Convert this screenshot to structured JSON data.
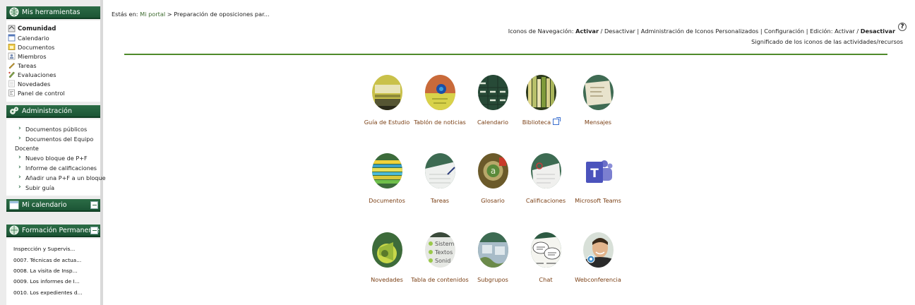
{
  "sidebar": {
    "tools": {
      "title": "Mis herramientas",
      "items": [
        {
          "label": "Comunidad",
          "icon": "home-icon",
          "bold": true
        },
        {
          "label": "Calendario",
          "icon": "calendar-icon"
        },
        {
          "label": "Documentos",
          "icon": "folder-icon"
        },
        {
          "label": "Miembros",
          "icon": "members-icon"
        },
        {
          "label": "Tareas",
          "icon": "pencil-icon"
        },
        {
          "label": "Evaluaciones",
          "icon": "evaluation-icon"
        },
        {
          "label": "Novedades",
          "icon": "news-icon"
        },
        {
          "label": "Panel de control",
          "icon": "control-panel-icon"
        }
      ]
    },
    "admin": {
      "title": "Administración",
      "items": [
        {
          "label": "Documentos públicos"
        },
        {
          "label": "Documentos del Equipo",
          "continuation": "Docente"
        },
        {
          "label": "Nuevo bloque de P+F"
        },
        {
          "label": "Informe de calificaciones"
        },
        {
          "label": "Añadir una P+F a un bloque"
        },
        {
          "label": "Subir guía"
        }
      ]
    },
    "calendar": {
      "title": "Mi calendario"
    },
    "formacion": {
      "title": "Formación Permanente",
      "items": [
        "Inspección y Supervis...",
        "0007. Técnicas de actua...",
        "0008. La visita de Insp...",
        "0009. Los informes de I...",
        "0010. Los expedientes d..."
      ]
    }
  },
  "breadcrumb": {
    "prefix": "Estás en:",
    "home": "Mi portal",
    "separator": ">",
    "current": "Preparación de oposiciones par..."
  },
  "navbar": {
    "icons_nav_label": "Iconos de Navegación:",
    "activar": "Activar",
    "slash": "/",
    "desactivar": "Desactivar",
    "pipe": "|",
    "admin_icons": "Administración de Iconos Personalizados",
    "config": "Configuración",
    "edicion_label": "Edición:",
    "edicion_activar": "Activar",
    "edicion_desactivar": "Desactivar",
    "help": "?",
    "meaning": "Significado de los iconos de las actividades/recursos"
  },
  "tiles": [
    {
      "id": "guia",
      "label": "Guía de Estudio",
      "icon": "study-guide-icon"
    },
    {
      "id": "tablon",
      "label": "Tablón de noticias",
      "icon": "noticeboard-icon"
    },
    {
      "id": "calendario",
      "label": "Calendario",
      "icon": "calendar-tile-icon"
    },
    {
      "id": "biblioteca",
      "label": "Biblioteca",
      "icon": "library-icon",
      "external": true
    },
    {
      "id": "mensajes",
      "label": "Mensajes",
      "icon": "messages-icon"
    },
    {
      "id": "documentos",
      "label": "Documentos",
      "icon": "documents-icon"
    },
    {
      "id": "tareas",
      "label": "Tareas",
      "icon": "tasks-icon"
    },
    {
      "id": "glosario",
      "label": "Glosario",
      "icon": "glossary-icon"
    },
    {
      "id": "calificaciones",
      "label": "Calificaciones",
      "icon": "grades-icon"
    },
    {
      "id": "teams",
      "label": "Microsoft Teams",
      "icon": "microsoft-teams-icon"
    },
    {
      "id": "novedades",
      "label": "Novedades",
      "icon": "news-megaphone-icon"
    },
    {
      "id": "tabla",
      "label": "Tabla de contenidos",
      "icon": "table-of-contents-icon",
      "thumb_text": [
        "Sistem",
        "Textos",
        "Sonid"
      ]
    },
    {
      "id": "subgrupos",
      "label": "Subgrupos",
      "icon": "subgroups-icon"
    },
    {
      "id": "chat",
      "label": "Chat",
      "icon": "chat-icon"
    },
    {
      "id": "webconf",
      "label": "Webconferencia",
      "icon": "webconference-icon"
    }
  ],
  "colors": {
    "sidebar_header": "#2c6c46",
    "divider": "#4f8a2b",
    "tile_label": "#7a3f14",
    "link": "#3d6b2f"
  }
}
